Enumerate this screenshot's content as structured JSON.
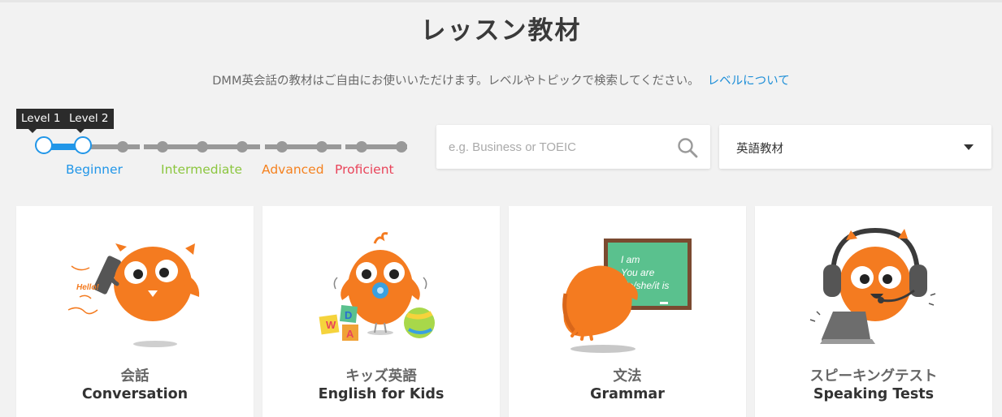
{
  "page": {
    "title": "レッスン教材",
    "subtitle": "DMM英会話の教材はご自由にお使いいただけます。レベルやトピックで検索してください。",
    "level_link": "レベルについて"
  },
  "level_slider": {
    "tooltip_start": "Level 1",
    "tooltip_end": "Level 2",
    "labels": [
      {
        "text": "Beginner",
        "color": "#2196e8"
      },
      {
        "text": "Intermediate",
        "color": "#8cc63f"
      },
      {
        "text": "Advanced",
        "color": "#f58220"
      },
      {
        "text": "Proficient",
        "color": "#e9445a"
      }
    ],
    "accent": "#2196e8"
  },
  "search": {
    "placeholder": "e.g. Business or TOEIC",
    "value": "",
    "icon": "search-icon"
  },
  "category_select": {
    "value": "英語教材",
    "icon": "caret-down-icon"
  },
  "cards": [
    {
      "jp": "会話",
      "en": "Conversation",
      "icon": "owl-phone-illustration"
    },
    {
      "jp": "キッズ英語",
      "en": "English for Kids",
      "icon": "owl-baby-illustration"
    },
    {
      "jp": "文法",
      "en": "Grammar",
      "icon": "owl-blackboard-illustration"
    },
    {
      "jp": "スピーキングテスト",
      "en": "Speaking Tests",
      "icon": "owl-headset-illustration"
    }
  ],
  "illustration_text": {
    "hello": "Hello!",
    "board_lines": [
      "I am",
      "You are",
      "He/she/it is"
    ],
    "blocks": [
      "W",
      "D",
      "A"
    ]
  },
  "colors": {
    "owl_orange": "#f47b20",
    "link_blue": "#1e8fd8",
    "board_green": "#5ac18e"
  }
}
